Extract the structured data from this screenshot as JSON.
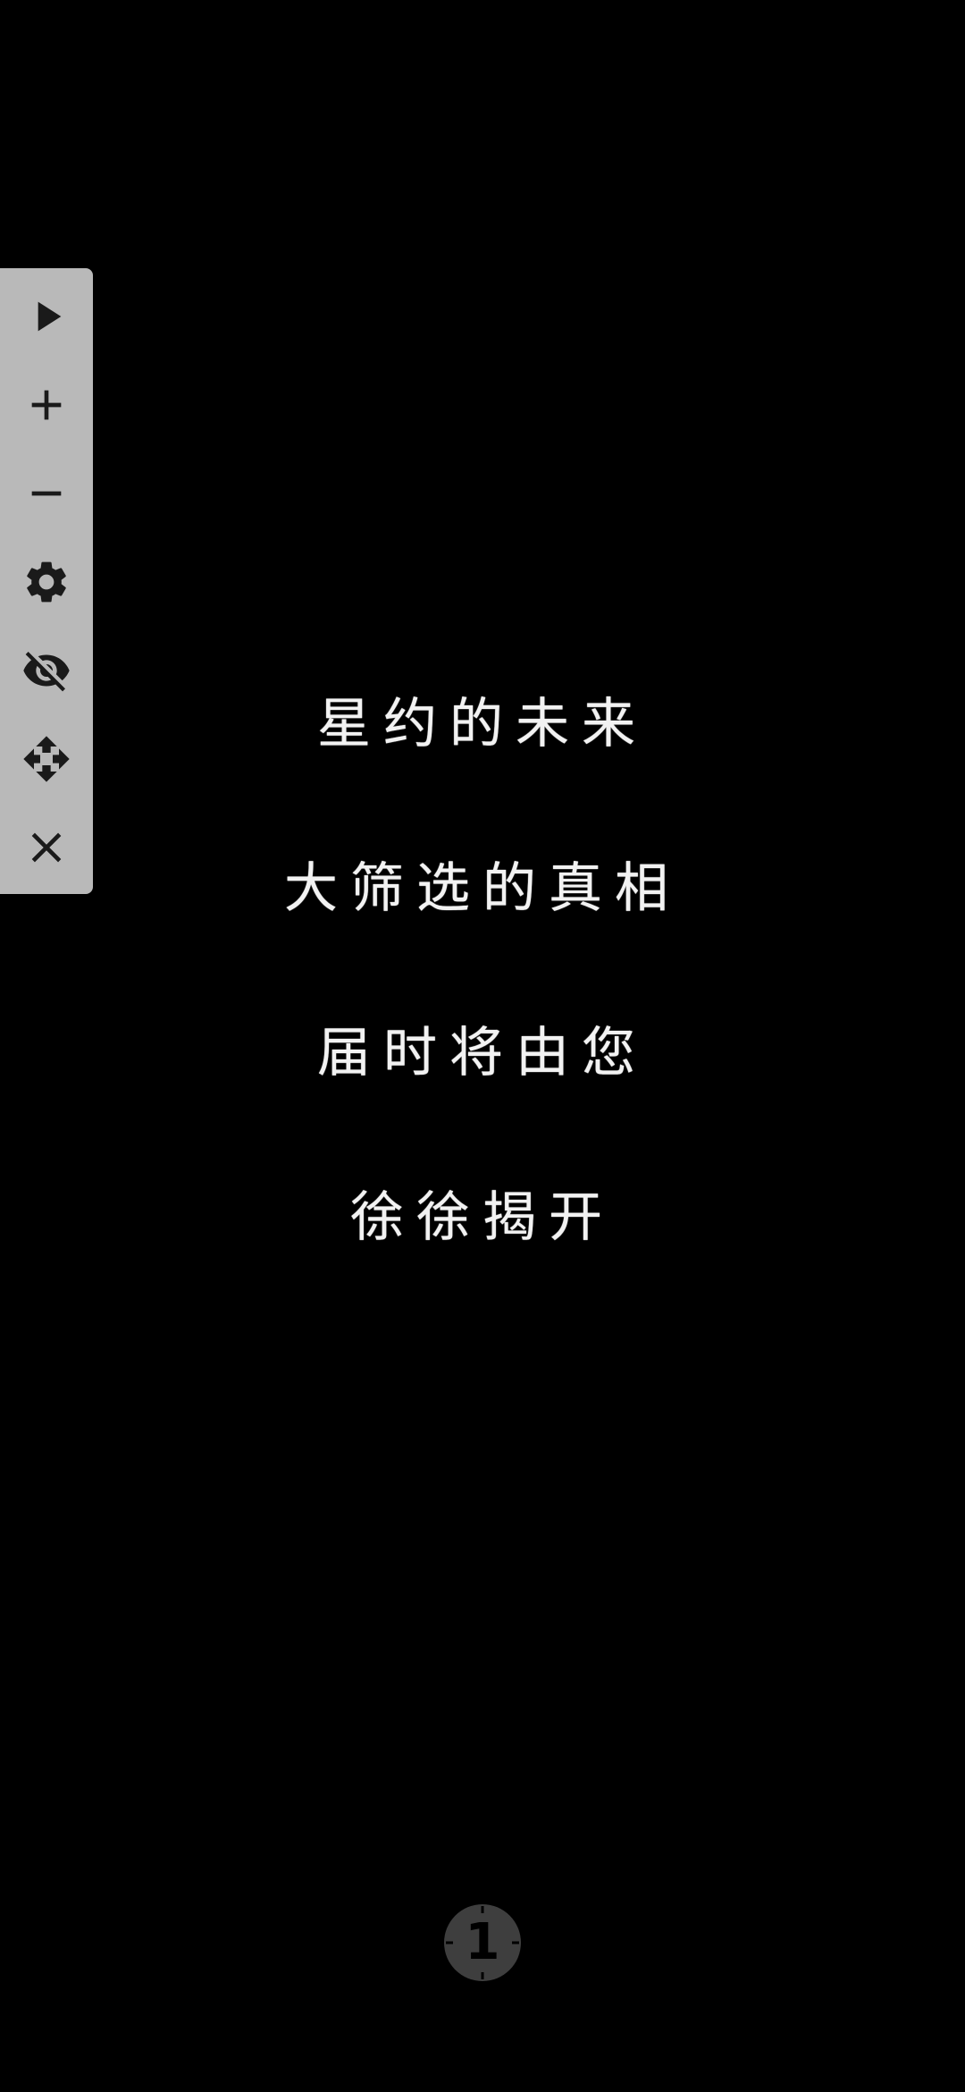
{
  "toolbar": {
    "buttons": [
      {
        "icon": "play-icon",
        "action": "play"
      },
      {
        "icon": "plus-icon",
        "action": "zoom-in"
      },
      {
        "icon": "minus-icon",
        "action": "zoom-out"
      },
      {
        "icon": "gear-icon",
        "action": "settings"
      },
      {
        "icon": "eye-off-icon",
        "action": "hide"
      },
      {
        "icon": "move-icon",
        "action": "move"
      },
      {
        "icon": "close-icon",
        "action": "close"
      }
    ],
    "background": "#b9b9b9",
    "icon_color": "#1a1a1a"
  },
  "story": {
    "lines": [
      "星约的未来",
      "大筛选的真相",
      "届时将由您",
      "徐徐揭开"
    ],
    "text_color": "#f2f2f2"
  },
  "page_indicator": {
    "number": "1",
    "background": "#3e3e3e"
  },
  "background_color": "#000000"
}
